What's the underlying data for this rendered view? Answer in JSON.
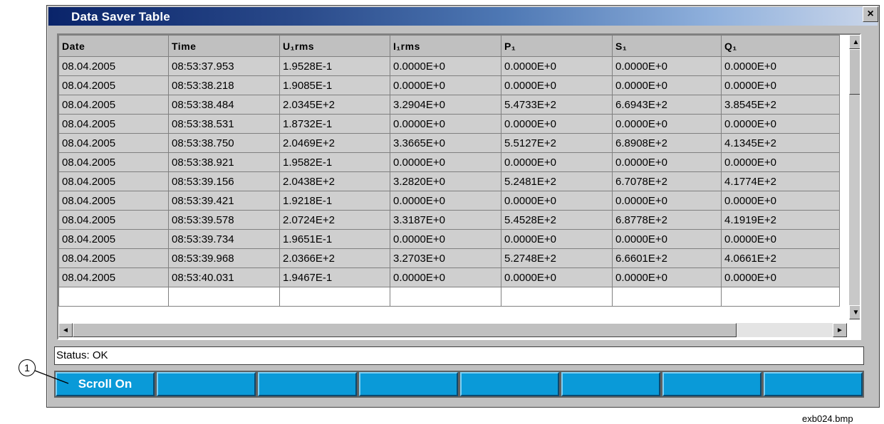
{
  "window": {
    "title": "Data Saver Table",
    "close_glyph": "×"
  },
  "table": {
    "columns": [
      "Date",
      "Time",
      "U₁rms",
      "I₁rms",
      "P₁",
      "S₁",
      "Q₁"
    ],
    "rows": [
      [
        "08.04.2005",
        "08:53:37.953",
        "1.9528E-1",
        "0.0000E+0",
        "0.0000E+0",
        "0.0000E+0",
        "0.0000E+0"
      ],
      [
        "08.04.2005",
        "08:53:38.218",
        "1.9085E-1",
        "0.0000E+0",
        "0.0000E+0",
        "0.0000E+0",
        "0.0000E+0"
      ],
      [
        "08.04.2005",
        "08:53:38.484",
        "2.0345E+2",
        "3.2904E+0",
        "5.4733E+2",
        "6.6943E+2",
        "3.8545E+2"
      ],
      [
        "08.04.2005",
        "08:53:38.531",
        "1.8732E-1",
        "0.0000E+0",
        "0.0000E+0",
        "0.0000E+0",
        "0.0000E+0"
      ],
      [
        "08.04.2005",
        "08:53:38.750",
        "2.0469E+2",
        "3.3665E+0",
        "5.5127E+2",
        "6.8908E+2",
        "4.1345E+2"
      ],
      [
        "08.04.2005",
        "08:53:38.921",
        "1.9582E-1",
        "0.0000E+0",
        "0.0000E+0",
        "0.0000E+0",
        "0.0000E+0"
      ],
      [
        "08.04.2005",
        "08:53:39.156",
        "2.0438E+2",
        "3.2820E+0",
        "5.2481E+2",
        "6.7078E+2",
        "4.1774E+2"
      ],
      [
        "08.04.2005",
        "08:53:39.421",
        "1.9218E-1",
        "0.0000E+0",
        "0.0000E+0",
        "0.0000E+0",
        "0.0000E+0"
      ],
      [
        "08.04.2005",
        "08:53:39.578",
        "2.0724E+2",
        "3.3187E+0",
        "5.4528E+2",
        "6.8778E+2",
        "4.1919E+2"
      ],
      [
        "08.04.2005",
        "08:53:39.734",
        "1.9651E-1",
        "0.0000E+0",
        "0.0000E+0",
        "0.0000E+0",
        "0.0000E+0"
      ],
      [
        "08.04.2005",
        "08:53:39.968",
        "2.0366E+2",
        "3.2703E+0",
        "5.2748E+2",
        "6.6601E+2",
        "4.0661E+2"
      ],
      [
        "08.04.2005",
        "08:53:40.031",
        "1.9467E-1",
        "0.0000E+0",
        "0.0000E+0",
        "0.0000E+0",
        "0.0000E+0"
      ]
    ]
  },
  "scrollbars": {
    "up_glyph": "▲",
    "down_glyph": "▼",
    "left_glyph": "◄",
    "right_glyph": "►"
  },
  "status": {
    "text": "Status: OK"
  },
  "buttons": {
    "labels": [
      "Scroll On",
      "",
      "",
      "",
      "",
      "",
      "",
      ""
    ]
  },
  "callout": {
    "label": "1"
  },
  "caption": "exb024.bmp",
  "colors": {
    "title_bar": "#0a246a",
    "button_face": "#0a9ad8"
  }
}
